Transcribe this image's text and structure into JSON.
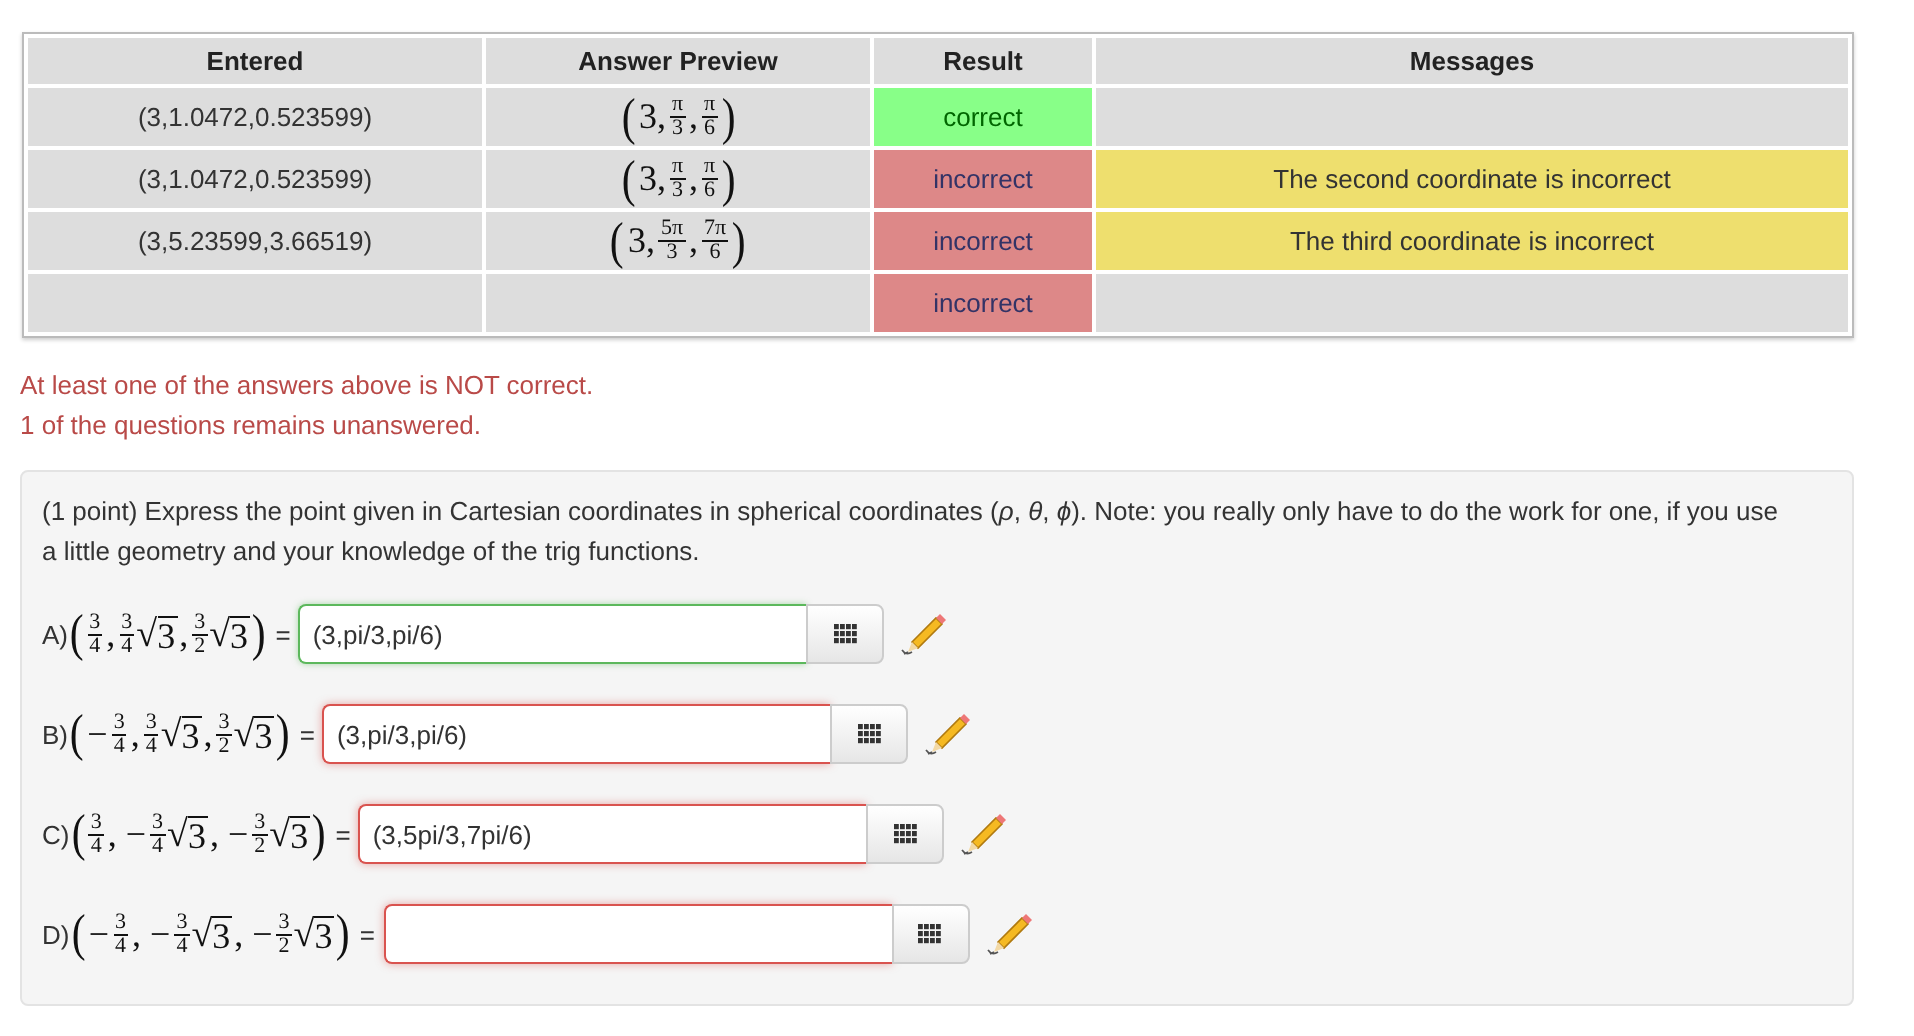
{
  "results_table": {
    "columns": [
      "Entered",
      "Answer Preview",
      "Result",
      "Messages"
    ],
    "rows": [
      {
        "entered": "(3,1.0472,0.523599)",
        "preview": [
          {
            "kind": "paren",
            "text": "("
          },
          {
            "kind": "text",
            "text": "3,"
          },
          {
            "kind": "frac",
            "num": "π",
            "den": "3"
          },
          {
            "kind": "text",
            "text": ","
          },
          {
            "kind": "frac",
            "num": "π",
            "den": "6"
          },
          {
            "kind": "paren",
            "text": ")"
          }
        ],
        "result": {
          "text": "correct",
          "kind": "correct"
        }
      },
      {
        "entered": "(3,1.0472,0.523599)",
        "preview": [
          {
            "kind": "paren",
            "text": "("
          },
          {
            "kind": "text",
            "text": "3,"
          },
          {
            "kind": "frac",
            "num": "π",
            "den": "3"
          },
          {
            "kind": "text",
            "text": ","
          },
          {
            "kind": "frac",
            "num": "π",
            "den": "6"
          },
          {
            "kind": "paren",
            "text": ")"
          }
        ],
        "result": {
          "text": "incorrect",
          "kind": "incorrect"
        },
        "message": "The second coordinate is incorrect"
      },
      {
        "entered": "(3,5.23599,3.66519)",
        "preview": [
          {
            "kind": "paren",
            "text": "("
          },
          {
            "kind": "text",
            "text": "3,"
          },
          {
            "kind": "frac",
            "num": "5π",
            "den": "3"
          },
          {
            "kind": "text",
            "text": ","
          },
          {
            "kind": "frac",
            "num": "7π",
            "den": "6"
          },
          {
            "kind": "paren",
            "text": ")"
          }
        ],
        "result": {
          "text": "incorrect",
          "kind": "incorrect"
        },
        "message": "The third coordinate is incorrect"
      },
      {
        "result": {
          "text": "incorrect",
          "kind": "incorrect"
        }
      }
    ]
  },
  "status_messages": [
    "At least one of the answers above is NOT correct.",
    "1 of the questions remains unanswered."
  ],
  "problem": {
    "text": "(1 point) Express the point given in Cartesian coordinates in spherical coordinates (*ρ*, *θ*, *ϕ*). Note: you really only have to do the work for one, if you use a little geometry and your knowledge of the trig functions.",
    "parts": [
      {
        "label": "A)",
        "expression": [
          {
            "kind": "paren",
            "text": "("
          },
          {
            "kind": "frac",
            "num": "3",
            "den": "4"
          },
          {
            "kind": "text",
            "text": ","
          },
          {
            "kind": "frac",
            "num": "3",
            "den": "4"
          },
          {
            "kind": "sqrt",
            "sign": "√",
            "text": "3"
          },
          {
            "kind": "text",
            "text": ","
          },
          {
            "kind": "frac",
            "num": "3",
            "den": "2"
          },
          {
            "kind": "sqrt",
            "sign": "√",
            "text": "3"
          },
          {
            "kind": "paren",
            "text": ")"
          }
        ],
        "equals": "=",
        "value": "(3,pi/3,pi/6)",
        "correct": true
      },
      {
        "label": "B)",
        "expression": [
          {
            "kind": "paren",
            "text": "("
          },
          {
            "kind": "text",
            "text": "−"
          },
          {
            "kind": "frac",
            "num": "3",
            "den": "4"
          },
          {
            "kind": "text",
            "text": ","
          },
          {
            "kind": "frac",
            "num": "3",
            "den": "4"
          },
          {
            "kind": "sqrt",
            "sign": "√",
            "text": "3"
          },
          {
            "kind": "text",
            "text": ","
          },
          {
            "kind": "frac",
            "num": "3",
            "den": "2"
          },
          {
            "kind": "sqrt",
            "sign": "√",
            "text": "3"
          },
          {
            "kind": "paren",
            "text": ")"
          }
        ],
        "equals": "=",
        "value": "(3,pi/3,pi/6)",
        "correct": false
      },
      {
        "label": "C)",
        "expression": [
          {
            "kind": "paren",
            "text": "("
          },
          {
            "kind": "frac",
            "num": "3",
            "den": "4"
          },
          {
            "kind": "text",
            "text": ", −"
          },
          {
            "kind": "frac",
            "num": "3",
            "den": "4"
          },
          {
            "kind": "sqrt",
            "sign": "√",
            "text": "3"
          },
          {
            "kind": "text",
            "text": ", −"
          },
          {
            "kind": "frac",
            "num": "3",
            "den": "2"
          },
          {
            "kind": "sqrt",
            "sign": "√",
            "text": "3"
          },
          {
            "kind": "paren",
            "text": ")"
          }
        ],
        "equals": "=",
        "value": "(3,5pi/3,7pi/6)",
        "correct": false
      },
      {
        "label": "D)",
        "expression": [
          {
            "kind": "paren",
            "text": "("
          },
          {
            "kind": "text",
            "text": "−"
          },
          {
            "kind": "frac",
            "num": "3",
            "den": "4"
          },
          {
            "kind": "text",
            "text": ", −"
          },
          {
            "kind": "frac",
            "num": "3",
            "den": "4"
          },
          {
            "kind": "sqrt",
            "sign": "√",
            "text": "3"
          },
          {
            "kind": "text",
            "text": ", −"
          },
          {
            "kind": "frac",
            "num": "3",
            "den": "2"
          },
          {
            "kind": "sqrt",
            "sign": "√",
            "text": "3"
          },
          {
            "kind": "paren",
            "text": ")"
          }
        ],
        "equals": "=",
        "correct": false
      }
    ]
  }
}
